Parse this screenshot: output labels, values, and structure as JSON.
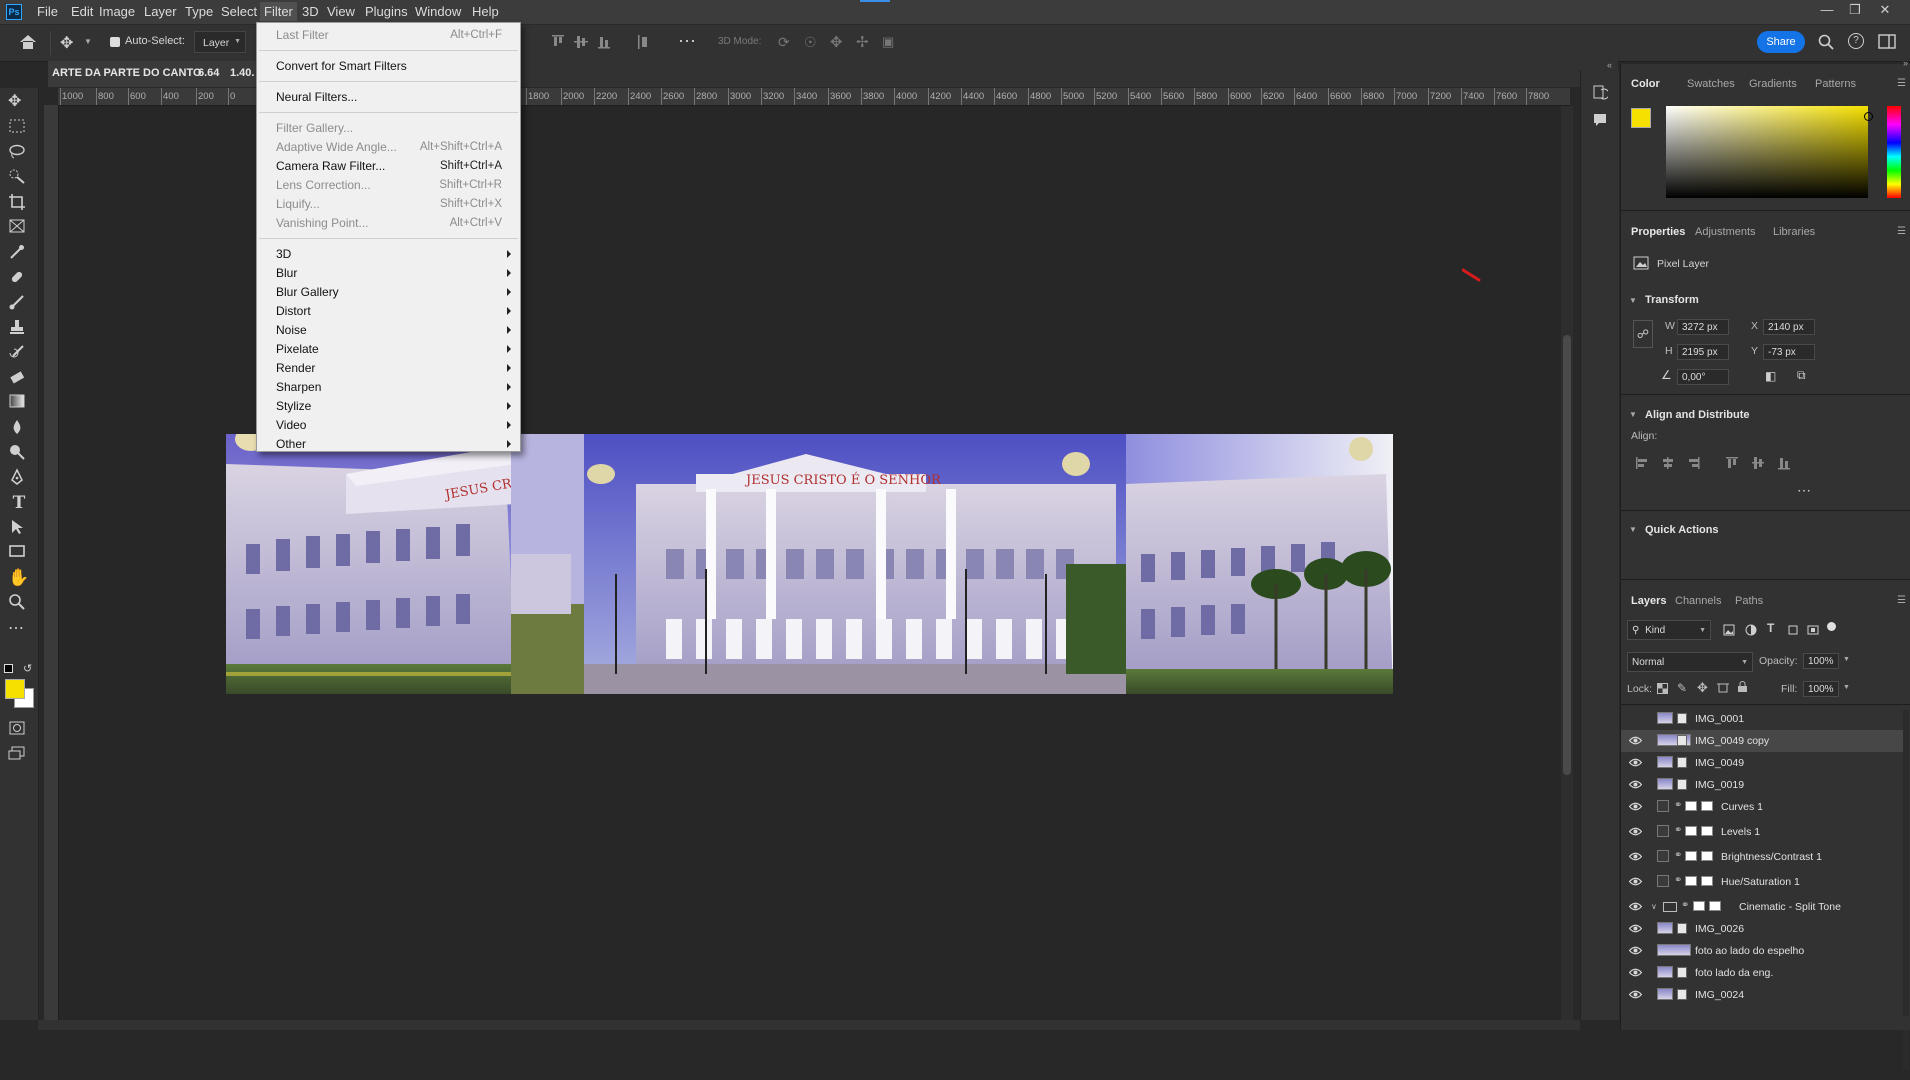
{
  "app": {
    "logo": "Ps"
  },
  "menubar": {
    "items": [
      "File",
      "Edit",
      "Image",
      "Layer",
      "Type",
      "Select",
      "Filter",
      "3D",
      "View",
      "Plugins",
      "Window",
      "Help"
    ],
    "active": "Filter"
  },
  "options_bar": {
    "auto_select_label": "Auto-Select:",
    "auto_select_value": "Layer",
    "mode_3d_label": "3D Mode:",
    "share_label": "Share"
  },
  "document": {
    "tab_title": "ARTE DA PARTE DO CANTO",
    "tab_zoom": "6.64",
    "tab_extra": "1.40."
  },
  "ruler_ticks": [
    "1000",
    "800",
    "600",
    "400",
    "200",
    "0",
    "1800",
    "2000",
    "2200",
    "2400",
    "2600",
    "2800",
    "3000",
    "3200",
    "3400",
    "3600",
    "3800",
    "4000",
    "4200",
    "4400",
    "4600",
    "4800",
    "5000",
    "5200",
    "5400",
    "5600",
    "5800",
    "6000",
    "6200",
    "6400",
    "6600",
    "6800",
    "7000",
    "7200",
    "7400",
    "7600",
    "7800"
  ],
  "image": {
    "sign_left": "JESUS CRIST",
    "sign_center": "JESUS CRISTO É O SENHOR"
  },
  "filter_menu": {
    "items": [
      {
        "label": "Last Filter",
        "shortcut": "Alt+Ctrl+F",
        "enabled": false
      },
      {
        "sep": true
      },
      {
        "label": "Convert for Smart Filters",
        "enabled": true
      },
      {
        "sep": true
      },
      {
        "label": "Neural Filters...",
        "enabled": true
      },
      {
        "sep": true
      },
      {
        "label": "Filter Gallery...",
        "enabled": false
      },
      {
        "label": "Adaptive Wide Angle...",
        "shortcut": "Alt+Shift+Ctrl+A",
        "enabled": false
      },
      {
        "label": "Camera Raw Filter...",
        "shortcut": "Shift+Ctrl+A",
        "enabled": true
      },
      {
        "label": "Lens Correction...",
        "shortcut": "Shift+Ctrl+R",
        "enabled": false
      },
      {
        "label": "Liquify...",
        "shortcut": "Shift+Ctrl+X",
        "enabled": false
      },
      {
        "label": "Vanishing Point...",
        "shortcut": "Alt+Ctrl+V",
        "enabled": false
      },
      {
        "sep": true
      },
      {
        "label": "3D",
        "submenu": true,
        "enabled": true
      },
      {
        "label": "Blur",
        "submenu": true,
        "enabled": true
      },
      {
        "label": "Blur Gallery",
        "submenu": true,
        "enabled": true
      },
      {
        "label": "Distort",
        "submenu": true,
        "enabled": true
      },
      {
        "label": "Noise",
        "submenu": true,
        "enabled": true
      },
      {
        "label": "Pixelate",
        "submenu": true,
        "enabled": true
      },
      {
        "label": "Render",
        "submenu": true,
        "enabled": true
      },
      {
        "label": "Sharpen",
        "submenu": true,
        "enabled": true
      },
      {
        "label": "Stylize",
        "submenu": true,
        "enabled": true
      },
      {
        "label": "Video",
        "submenu": true,
        "enabled": true
      },
      {
        "label": "Other",
        "submenu": true,
        "enabled": true
      }
    ]
  },
  "color_panel": {
    "tabs": [
      "Color",
      "Swatches",
      "Gradients",
      "Patterns"
    ],
    "foreground": "#f5e000"
  },
  "properties_panel": {
    "tabs": [
      "Properties",
      "Adjustments",
      "Libraries"
    ],
    "layer_type": "Pixel Layer",
    "transform_title": "Transform",
    "w_label": "W",
    "w_value": "3272 px",
    "h_label": "H",
    "h_value": "2195 px",
    "x_label": "X",
    "x_value": "2140 px",
    "y_label": "Y",
    "y_value": "-73 px",
    "angle_value": "0,00°",
    "align_title": "Align and Distribute",
    "align_label": "Align:",
    "quick_actions_title": "Quick Actions"
  },
  "layers_panel": {
    "tabs": [
      "Layers",
      "Channels",
      "Paths"
    ],
    "filter_kind": "Kind",
    "blend_mode": "Normal",
    "opacity_label": "Opacity:",
    "opacity_value": "100%",
    "lock_label": "Lock:",
    "fill_label": "Fill:",
    "fill_value": "100%",
    "layers": [
      {
        "name": "IMG_0001",
        "visible": false,
        "kind": "pixel"
      },
      {
        "name": "IMG_0049 copy",
        "visible": true,
        "kind": "pixel",
        "selected": true
      },
      {
        "name": "IMG_0049",
        "visible": true,
        "kind": "pixel"
      },
      {
        "name": "IMG_0019",
        "visible": true,
        "kind": "pixel"
      },
      {
        "name": "Curves 1",
        "visible": true,
        "kind": "adjustment"
      },
      {
        "name": "Levels 1",
        "visible": true,
        "kind": "adjustment"
      },
      {
        "name": "Brightness/Contrast 1",
        "visible": true,
        "kind": "adjustment"
      },
      {
        "name": "Hue/Saturation 1",
        "visible": true,
        "kind": "adjustment"
      },
      {
        "name": "Cinematic - Split Tone",
        "visible": true,
        "kind": "group"
      },
      {
        "name": "IMG_0026",
        "visible": true,
        "kind": "pixel"
      },
      {
        "name": "foto ao lado do espelho",
        "visible": true,
        "kind": "pixel-wide"
      },
      {
        "name": "foto lado da eng.",
        "visible": true,
        "kind": "pixel"
      },
      {
        "name": "IMG_0024",
        "visible": true,
        "kind": "pixel"
      }
    ]
  }
}
